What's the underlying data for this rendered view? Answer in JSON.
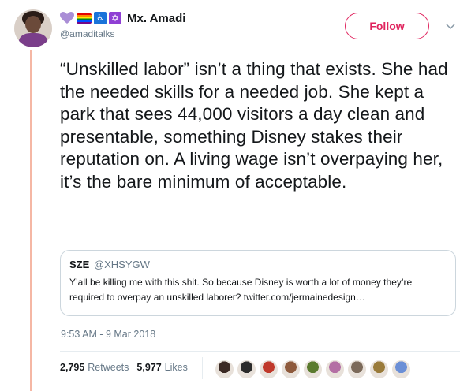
{
  "author": {
    "display_name": "Mx. Amadi",
    "handle": "@amaditalks",
    "name_emojis": [
      "purple-heart",
      "rainbow-flag",
      "wheelchair-symbol",
      "star-of-david"
    ]
  },
  "follow_button": {
    "label": "Follow"
  },
  "tweet": {
    "text": "“Unskilled labor” isn’t a thing that exists. She had the needed skills for a needed job. She kept a park that sees 44,000 visitors a day clean and presentable, something Disney stakes their reputation on. A living wage isn’t overpaying her, it’s the bare minimum of acceptable.",
    "timestamp": "9:53 AM - 9 Mar 2018"
  },
  "quoted_tweet": {
    "name": "SZE",
    "handle": "@XHSYGW",
    "text": "Y’all be killing me with this shit. So because Disney is worth a lot of money they’re required to overpay an unskilled laborer? twitter.com/jermainedesign…"
  },
  "stats": {
    "retweets_count": "2,795",
    "retweets_label": "Retweets",
    "likes_count": "5,977",
    "likes_label": "Likes"
  },
  "likers": [
    {
      "color": "#3b2a24"
    },
    {
      "color": "#2b2b2b"
    },
    {
      "color": "#c0392b"
    },
    {
      "color": "#8e5a3c"
    },
    {
      "color": "#5b7a2e"
    },
    {
      "color": "#b46fa4"
    },
    {
      "color": "#7c6a5a"
    },
    {
      "color": "#9a7b3a"
    },
    {
      "color": "#6b8fd6"
    }
  ],
  "colors": {
    "accent": "#e0245e",
    "muted": "#657786",
    "thread_line": "#f5b7a4"
  }
}
